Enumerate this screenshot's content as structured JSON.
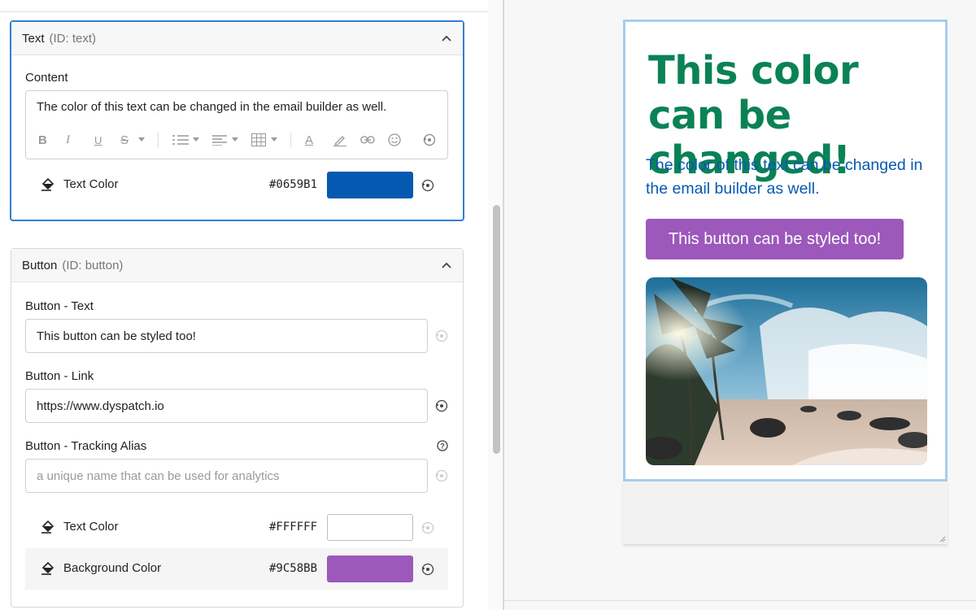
{
  "text_panel": {
    "title": "Text",
    "id_label": "(ID: text)",
    "content_label": "Content",
    "content_value": "The color of this text can be changed in the email builder as well.",
    "text_color_label": "Text Color",
    "text_color_hex": "#0659B1"
  },
  "button_panel": {
    "title": "Button",
    "id_label": "(ID: button)",
    "text_label": "Button - Text",
    "text_value": "This button can be styled too!",
    "link_label": "Button - Link",
    "link_value": "https://www.dyspatch.io",
    "alias_label": "Button - Tracking Alias",
    "alias_placeholder": "a unique name that can be used for analytics",
    "text_color_label": "Text Color",
    "text_color_hex": "#FFFFFF",
    "bg_color_label": "Background Color",
    "bg_color_hex": "#9C58BB"
  },
  "toolbar": {
    "icons": [
      "bold-icon",
      "italic-icon",
      "underline-icon",
      "strikethrough-icon",
      "list-icon",
      "align-icon",
      "table-icon",
      "font-color-icon",
      "highlight-icon",
      "link-icon",
      "emoji-icon",
      "reset-icon"
    ],
    "bold": "B",
    "italic": "I",
    "underline": "U",
    "strike": "S",
    "font_color": "A"
  },
  "preview": {
    "heading": "This color can be changed!",
    "heading_color": "#0A8256",
    "paragraph": "The color of this text can be changed in the email builder as well.",
    "paragraph_color": "#0659B1",
    "button_label": "This button can be styled too!",
    "button_bg": "#9C58BB",
    "button_text_color": "#FFFFFF",
    "image": "beach-photo"
  }
}
